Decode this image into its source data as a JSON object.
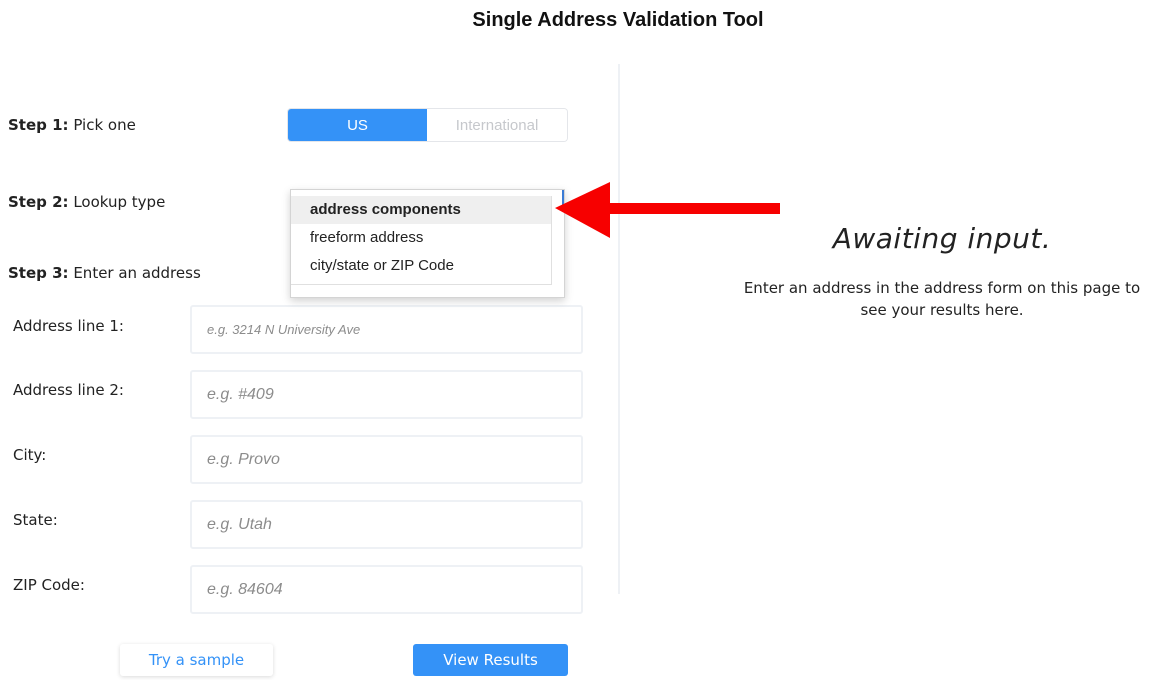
{
  "header": {
    "title": "Single Address Validation Tool"
  },
  "steps": {
    "step1": {
      "prefix": "Step 1:",
      "label": "Pick one"
    },
    "step2": {
      "prefix": "Step 2:",
      "label": "Lookup type"
    },
    "step3": {
      "prefix": "Step 3:",
      "label": "Enter an address"
    }
  },
  "country_toggle": {
    "options": [
      "US",
      "International"
    ],
    "selected": "US"
  },
  "lookup_dropdown": {
    "options": [
      "address components",
      "freeform address",
      "city/state or ZIP Code"
    ],
    "selected": "address components",
    "expanded": true
  },
  "annotation": {
    "icon": "red-arrow-icon",
    "color": "#f70000"
  },
  "form": {
    "fields": [
      {
        "label": "Address line 1:",
        "placeholder": "e.g. 3214 N University Ave",
        "value": ""
      },
      {
        "label": "Address line 2:",
        "placeholder": "e.g. #409",
        "value": ""
      },
      {
        "label": "City:",
        "placeholder": "e.g. Provo",
        "value": ""
      },
      {
        "label": "State:",
        "placeholder": "e.g. Utah",
        "value": ""
      },
      {
        "label": "ZIP Code:",
        "placeholder": "e.g. 84604",
        "value": ""
      }
    ],
    "try_sample_label": "Try a sample",
    "view_results_label": "View Results"
  },
  "results_panel": {
    "title": "Awaiting input.",
    "message": "Enter an address in the address form on this page to see your results here."
  },
  "colors": {
    "accent": "#3492f7",
    "annotation_red": "#f70000"
  }
}
